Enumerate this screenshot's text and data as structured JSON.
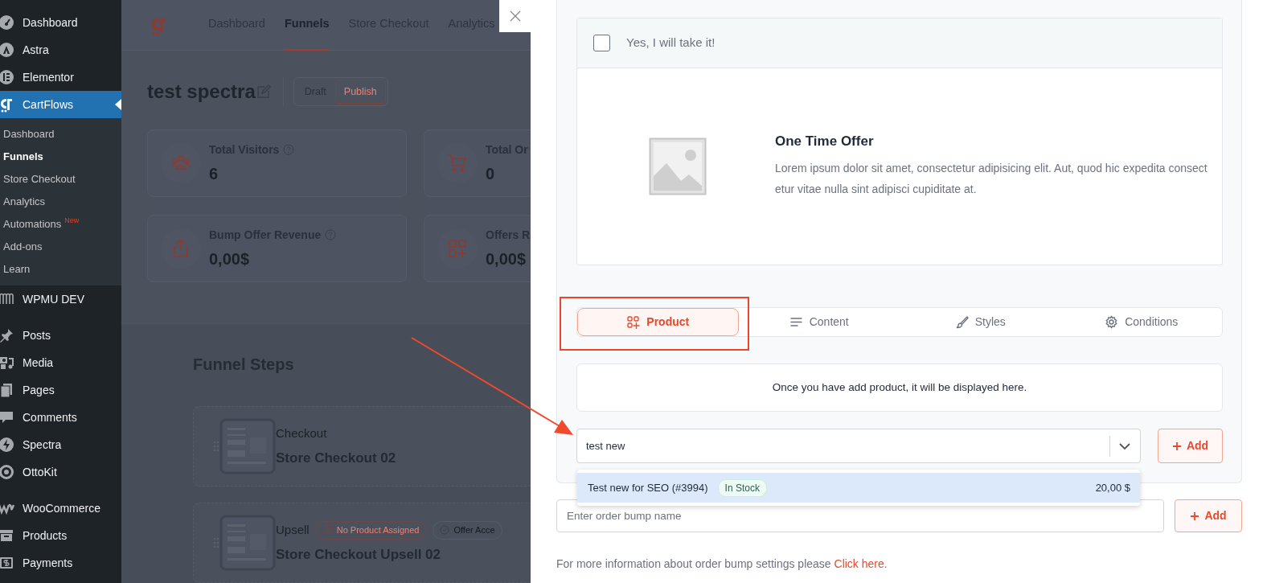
{
  "sidebar": {
    "groups": [
      {
        "items": [
          {
            "label": "Dashboard",
            "selected": false
          },
          {
            "label": "Astra",
            "selected": false
          },
          {
            "label": "Elementor",
            "selected": false
          },
          {
            "label": "CartFlows",
            "selected": true,
            "submenu": [
              {
                "label": "Dashboard",
                "selected": false
              },
              {
                "label": "Funnels",
                "selected": true
              },
              {
                "label": "Store Checkout",
                "selected": false
              },
              {
                "label": "Analytics",
                "selected": false
              },
              {
                "label": "Automations",
                "selected": false,
                "badge": "New"
              },
              {
                "label": "Add-ons",
                "selected": false
              },
              {
                "label": "Learn",
                "selected": false
              }
            ]
          },
          {
            "label": "WPMU DEV",
            "selected": false
          }
        ]
      },
      {
        "items": [
          {
            "label": "Posts",
            "selected": false
          },
          {
            "label": "Media",
            "selected": false
          },
          {
            "label": "Pages",
            "selected": false
          },
          {
            "label": "Comments",
            "selected": false
          },
          {
            "label": "Spectra",
            "selected": false
          },
          {
            "label": "OttoKit",
            "selected": false
          }
        ]
      },
      {
        "items": [
          {
            "label": "WooCommerce",
            "selected": false
          },
          {
            "label": "Products",
            "selected": false
          },
          {
            "label": "Payments",
            "selected": false
          }
        ]
      }
    ]
  },
  "funnel_page": {
    "nav": [
      {
        "label": "Dashboard",
        "selected": false
      },
      {
        "label": "Funnels",
        "selected": true
      },
      {
        "label": "Store Checkout",
        "selected": false
      },
      {
        "label": "Analytics",
        "selected": false
      }
    ],
    "title": "test spectra",
    "status_toggle": [
      {
        "label": "Draft",
        "selected": false
      },
      {
        "label": "Publish",
        "selected": true
      }
    ],
    "stats": [
      {
        "label": "Total Visitors",
        "value": "6",
        "help": true
      },
      {
        "label": "Total Or",
        "value": "0",
        "help": false
      },
      {
        "label": "Bump Offer Revenue",
        "value": "0,00$",
        "help": true
      },
      {
        "label": "Offers R",
        "value": "0,00$",
        "help": false
      }
    ],
    "section_title": "Funnel Steps",
    "steps": [
      {
        "type": "Checkout",
        "name": "Store Checkout 02"
      },
      {
        "type": "Upsell",
        "name": "Store Checkout Upsell 02",
        "badges": [
          {
            "kind": "warning",
            "label": "No Product Assigned"
          },
          {
            "kind": "success",
            "label": "Offer Acce"
          }
        ]
      }
    ]
  },
  "drawer": {
    "preview": {
      "checkbox_label": "Yes, I will take it!",
      "checked": false,
      "title": "One Time Offer",
      "description": "Lorem ipsum dolor sit amet, consectetur adipisicing elit. Aut, quod hic expedita consectetur vitae nulla sint adipisci cupiditate at."
    },
    "tabs": [
      {
        "label": "Product",
        "selected": true
      },
      {
        "label": "Content",
        "selected": false
      },
      {
        "label": "Styles",
        "selected": false
      },
      {
        "label": "Conditions",
        "selected": false
      }
    ],
    "empty_message": "Once you have add product, it will be displayed here.",
    "product_select": {
      "value": "test new",
      "add_label": "Add"
    },
    "dropdown": [
      {
        "name": "Test new for SEO (#3994)",
        "stock": "In Stock",
        "price": "20,00 $",
        "selected": true
      }
    ],
    "order_bump": {
      "placeholder": "Enter order bump name",
      "add_label": "Add"
    },
    "footer": {
      "text": "For more information about order bump settings please",
      "link": "Click here."
    }
  }
}
